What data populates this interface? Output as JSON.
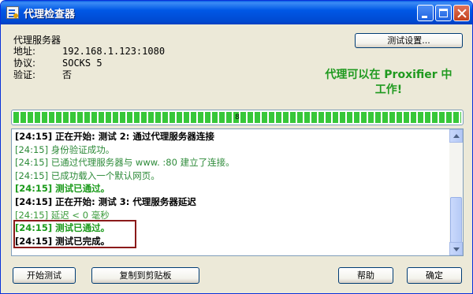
{
  "window": {
    "title": "代理检查器",
    "buttons": {
      "minimize": "minimize-icon",
      "maximize": "maximize-icon",
      "close": "close-icon"
    }
  },
  "info": {
    "title": "代理服务器",
    "address": {
      "label": "地址:",
      "value": "192.168.1.123:1080"
    },
    "protocol": {
      "label": "协议:",
      "value": "SOCKS 5"
    },
    "auth": {
      "label": "验证:",
      "value": "否"
    }
  },
  "settings_button": "测试设置...",
  "result": {
    "line1": "代理可以在 Proxifier 中",
    "line2": "工作!"
  },
  "progress": {
    "label": "8",
    "percent": 100
  },
  "log": [
    {
      "time": "[24:15]",
      "text": "正在开始: 测试 2: 通过代理服务器连接",
      "style": "header"
    },
    {
      "time": "[24:15]",
      "text": "身份验证成功。",
      "style": "info"
    },
    {
      "time": "[24:15]",
      "text": "已通过代理服务器与 www.           :80 建立了连接。",
      "style": "info"
    },
    {
      "time": "[24:15]",
      "text": "已成功载入一个默认网页。",
      "style": "info"
    },
    {
      "time": "[24:15]",
      "text": "测试已通过。",
      "style": "pass"
    },
    {
      "time": "[24:15]",
      "text": "正在开始: 测试 3: 代理服务器延迟",
      "style": "header"
    },
    {
      "time": "[24:15]",
      "text": "延迟 < 0 毫秒",
      "style": "muted"
    },
    {
      "time": "[24:15]",
      "text": "测试已通过。",
      "style": "pass"
    },
    {
      "time": "[24:15]",
      "text": "测试已完成。",
      "style": "done"
    }
  ],
  "buttons": {
    "start": "开始测试",
    "copy": "复制到剪贴板",
    "help": "帮助",
    "ok": "确定"
  },
  "colors": {
    "titlebar": "#0058e6",
    "success_text": "#1f9a1f",
    "progress": "#37c739",
    "highlight_border": "#8b1a1a"
  }
}
